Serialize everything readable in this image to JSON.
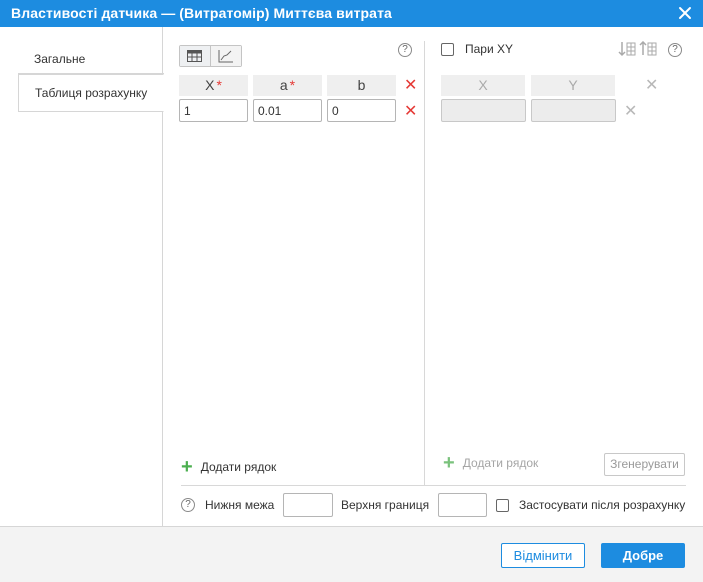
{
  "window": {
    "title": "Властивості датчика — (Витратомір) Миттєва витрата"
  },
  "sidebar": {
    "items": [
      {
        "label": "Загальне",
        "active": false
      },
      {
        "label": "Таблиця розрахунку",
        "active": true
      }
    ]
  },
  "toolbar": {
    "active_view": "table",
    "views": [
      "table-icon",
      "graph-icon"
    ]
  },
  "calc_table": {
    "columns": [
      {
        "label": "X",
        "required": true
      },
      {
        "label": "a",
        "required": true
      },
      {
        "label": "b",
        "required": false
      }
    ],
    "rows": [
      {
        "x": "1",
        "a": "0.01",
        "b": "0"
      }
    ],
    "add_row_label": "Додати рядок"
  },
  "xy_panel": {
    "pairs_label": "Пари XY",
    "pairs_checked": false,
    "columns": [
      "X",
      "Y"
    ],
    "row": {
      "x": "",
      "y": ""
    },
    "add_row_label": "Додати рядок",
    "generate_label": "Згенерувати"
  },
  "limits": {
    "lower_label": "Нижня межа",
    "lower_value": "",
    "upper_label": "Верхня границя",
    "upper_value": "",
    "apply_label": "Застосувати після розрахунку",
    "apply_checked": false
  },
  "footer": {
    "cancel_label": "Відмінити",
    "ok_label": "Добре"
  },
  "colors": {
    "accent": "#1d8ce0",
    "delete": "#e53935",
    "add": "#4caf50"
  }
}
